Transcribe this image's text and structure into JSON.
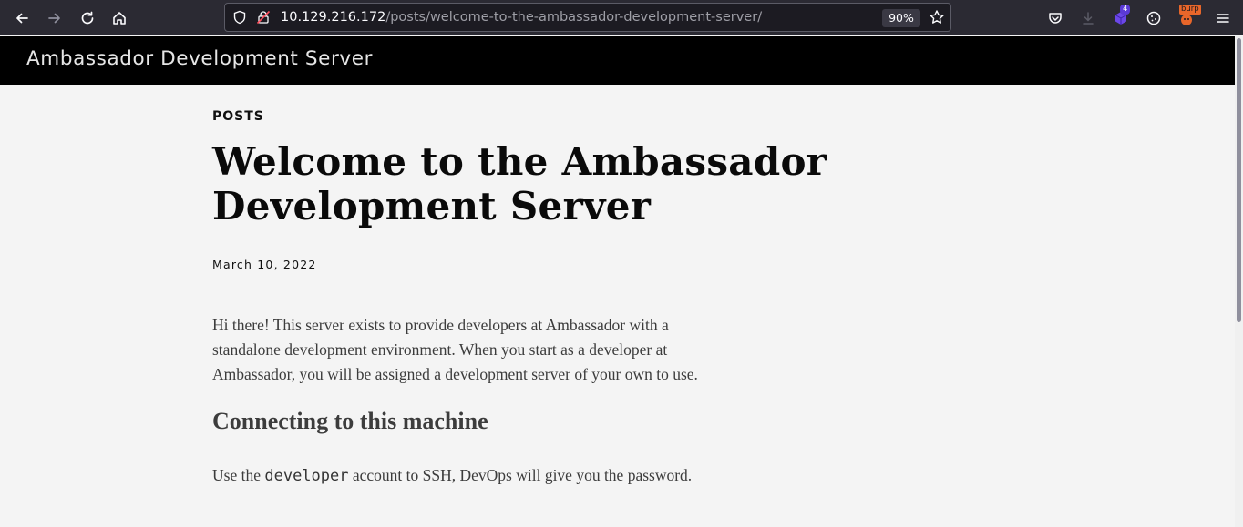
{
  "browser": {
    "url_host": "10.129.216.172",
    "url_path": "/posts/welcome-to-the-ambassador-development-server/",
    "zoom": "90%",
    "extension_badge_count": "4",
    "burp_label": "burp"
  },
  "site": {
    "title": "Ambassador Development Server"
  },
  "post": {
    "section": "POSTS",
    "title": "Welcome to the Ambassador Development Server",
    "date": "March 10, 2022",
    "intro": "Hi there! This server exists to provide developers at Ambassador with a standalone development environment. When you start as a developer at Ambassador, you will be assigned a development server of your own to use.",
    "heading": "Connecting to this machine",
    "p2_before": "Use the ",
    "p2_code": "developer",
    "p2_after": " account to SSH, DevOps will give you the password."
  },
  "colors": {
    "toolbar_bg": "#2b2a33",
    "header_bg": "#000000",
    "page_bg": "#f4f4f4"
  }
}
